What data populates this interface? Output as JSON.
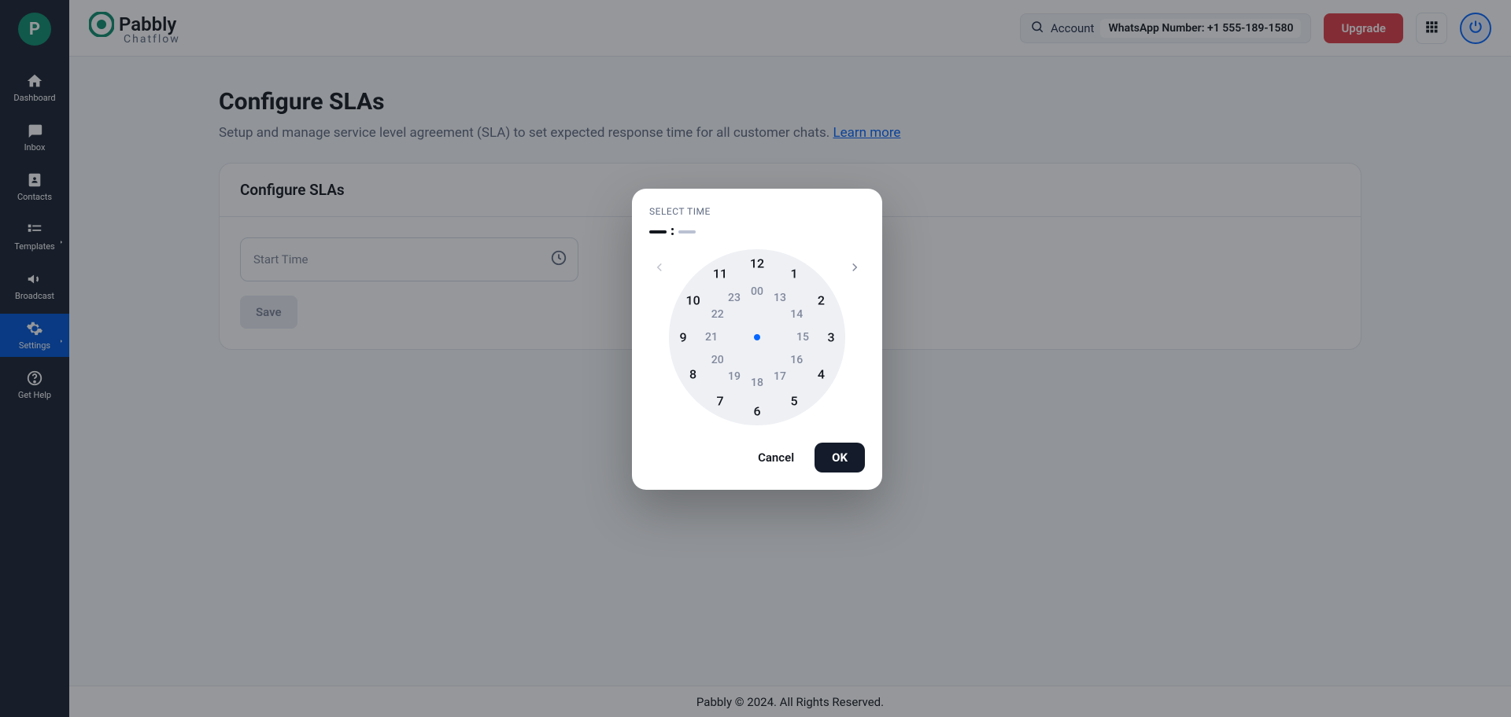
{
  "brand": {
    "name": "Pabbly",
    "sub": "Chatflow"
  },
  "sidebar": {
    "items": [
      {
        "label": "Dashboard"
      },
      {
        "label": "Inbox"
      },
      {
        "label": "Contacts"
      },
      {
        "label": "Templates"
      },
      {
        "label": "Broadcast"
      },
      {
        "label": "Settings"
      },
      {
        "label": "Get Help"
      }
    ]
  },
  "topbar": {
    "account": "Account",
    "whatsapp": "WhatsApp Number: +1 555-189-1580",
    "upgrade": "Upgrade"
  },
  "page": {
    "title": "Configure SLAs",
    "desc": "Setup and manage service level agreement (SLA) to set expected response time for all customer chats. ",
    "learn": "Learn more"
  },
  "card": {
    "header": "Configure SLAs",
    "startPlaceholder": "Start Time",
    "save": "Save"
  },
  "dialog": {
    "title": "SELECT TIME",
    "outer": [
      "12",
      "1",
      "2",
      "3",
      "4",
      "5",
      "6",
      "7",
      "8",
      "9",
      "10",
      "11"
    ],
    "inner": [
      "00",
      "13",
      "14",
      "15",
      "16",
      "17",
      "18",
      "19",
      "20",
      "21",
      "22",
      "23"
    ],
    "cancel": "Cancel",
    "ok": "OK"
  },
  "footer": "Pabbly © 2024. All Rights Reserved."
}
